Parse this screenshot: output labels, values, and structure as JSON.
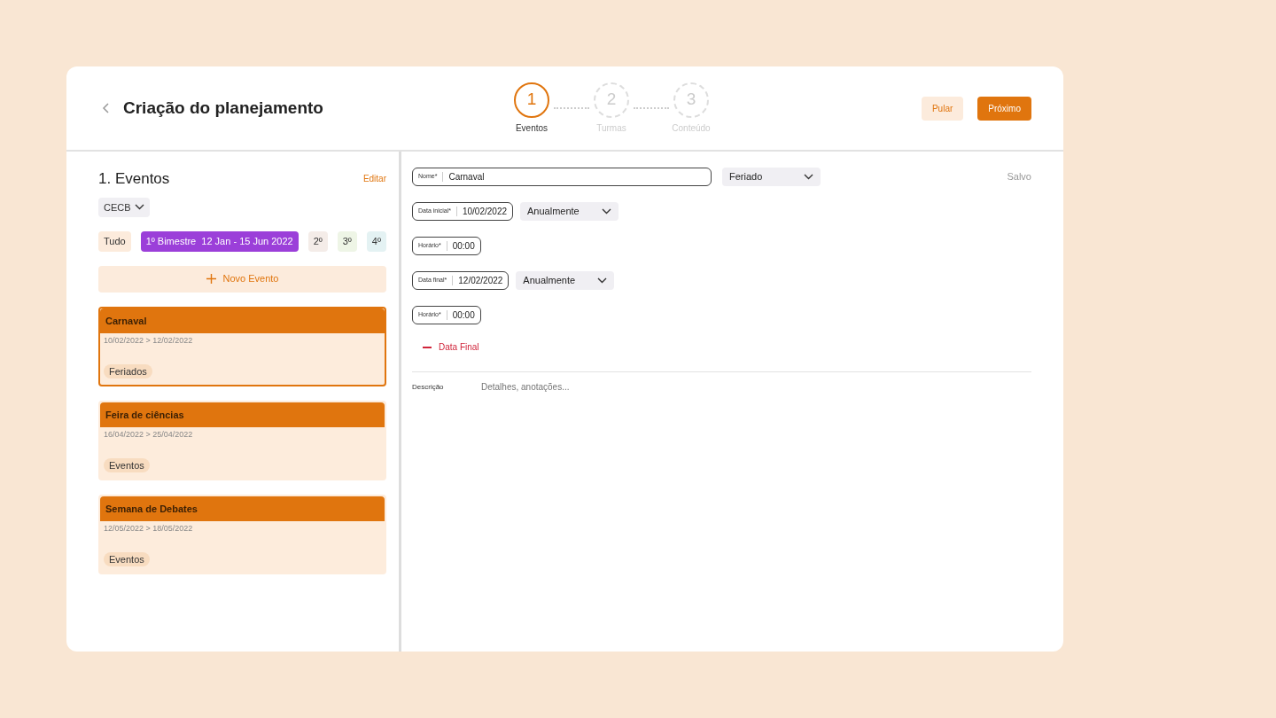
{
  "header": {
    "title": "Criação do planejamento",
    "steps": [
      {
        "number": "1",
        "label": "Eventos",
        "selected": true
      },
      {
        "number": "2",
        "label": "Turmas",
        "selected": false
      },
      {
        "number": "3",
        "label": "Conteúdo",
        "selected": false
      }
    ],
    "buttons": [
      {
        "label": "Pular",
        "kind": "secondary"
      },
      {
        "label": "Próximo",
        "kind": "primary"
      }
    ]
  },
  "sidebar": {
    "title": "1. Eventos",
    "edit": "Editar",
    "school": "CECB",
    "filters": [
      {
        "label": "Tudo",
        "color": "#fcebdc",
        "selected": false
      },
      {
        "label": "1º Bimestre",
        "range": "12 Jan - 15 Jun 2022",
        "color": "#9b3fd9",
        "selected": true
      },
      {
        "label": "2º",
        "color": "#f4ece8",
        "selected": false
      },
      {
        "label": "3º",
        "color": "#eef5e6",
        "selected": false
      },
      {
        "label": "4º",
        "color": "#e4f2f3",
        "selected": false
      }
    ],
    "new_event": "Novo Evento",
    "events": [
      {
        "name": "Carnaval",
        "dates": "10/02/2022 > 12/02/2022",
        "tag": "Feriados",
        "selected": true
      },
      {
        "name": "Feira de ciências",
        "dates": "16/04/2022 > 25/04/2022",
        "tag": "Eventos",
        "selected": false
      },
      {
        "name": "Semana de Debates",
        "dates": "12/05/2022 > 18/05/2022",
        "tag": "Eventos",
        "selected": false
      }
    ]
  },
  "form": {
    "status": "Salvo",
    "rows": [
      [
        {
          "kind": "field",
          "label": "Nome*",
          "value": "Carnaval",
          "wide": true
        },
        {
          "kind": "select",
          "value": "Feriado"
        }
      ],
      [
        {
          "kind": "field",
          "label": "Data inicial*",
          "value": "10/02/2022"
        },
        {
          "kind": "select",
          "value": "Anualmente"
        }
      ],
      [
        {
          "kind": "field",
          "label": "Horário*",
          "value": "00:00"
        }
      ],
      [
        {
          "kind": "field",
          "label": "Data final*",
          "value": "12/02/2022"
        },
        {
          "kind": "select",
          "value": "Anualmente"
        }
      ],
      [
        {
          "kind": "field",
          "label": "Horário*",
          "value": "00:00"
        }
      ]
    ],
    "remove_end": "Data Final",
    "description_label": "Descrição",
    "description_placeholder": "Detalhes, anotações..."
  }
}
